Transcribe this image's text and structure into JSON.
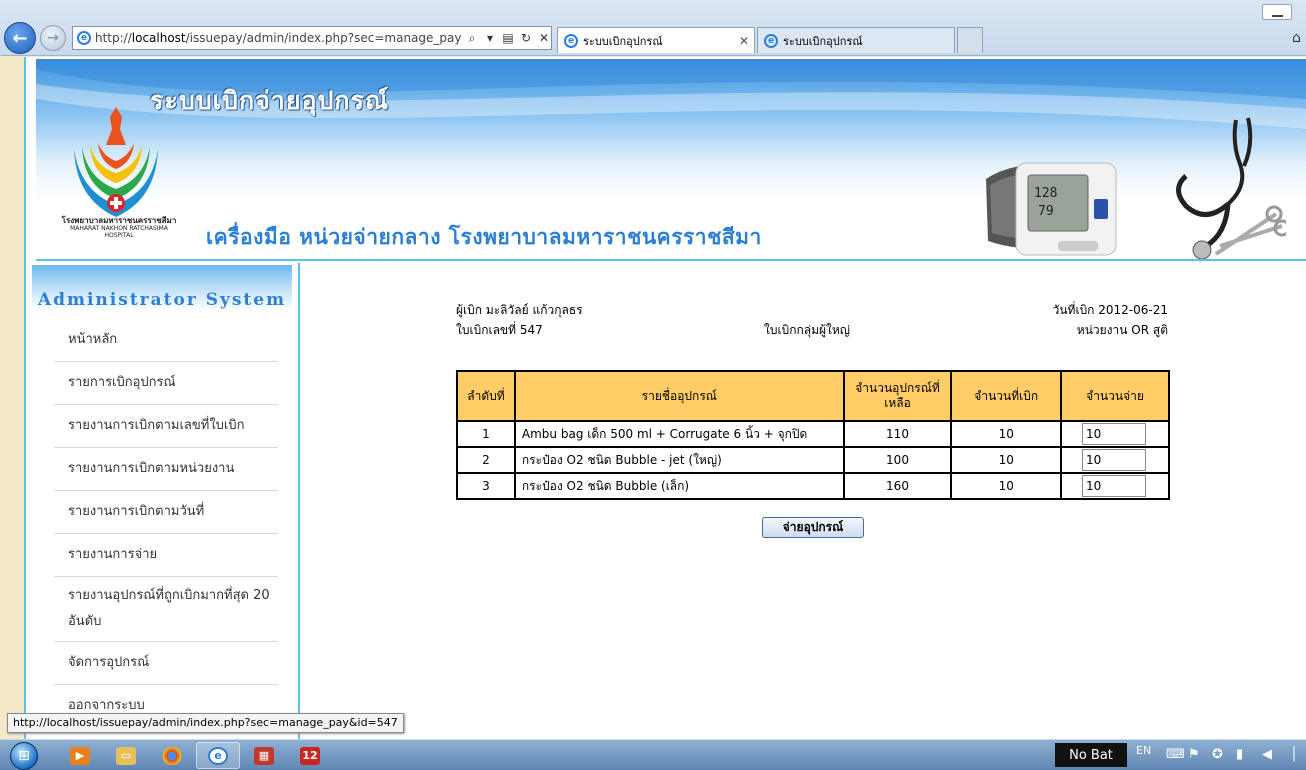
{
  "browser": {
    "url_prefix": "http://",
    "url_host": "localhost",
    "url_path": "/issuepay/admin/index.php?sec=manage_pay&id=547",
    "tabs": [
      {
        "title": "ระบบเบิกอุปกรณ์"
      },
      {
        "title": "ระบบเบิกอุปกรณ์"
      }
    ],
    "status_url": "http://localhost/issuepay/admin/index.php?sec=manage_pay&id=547"
  },
  "banner": {
    "system_title": "ระบบเบิกจ่ายอุปกรณ์",
    "unit_heading": "เครื่องมือ หน่วยจ่ายกลาง โรงพยาบาลมหาราชนครราชสีมา",
    "logo_caption_th": "โรงพยาบาลมหาราชนครราชสีมา",
    "logo_caption_en": "MAHARAT NAKHON RATCHASIMA HOSPITAL"
  },
  "sidebar": {
    "title": "Administrator System",
    "items": [
      {
        "label": "หน้าหลัก"
      },
      {
        "label": "รายการเบิกอุปกรณ์"
      },
      {
        "label": "รายงานการเบิกตามเลขที่ใบเบิก"
      },
      {
        "label": "รายงานการเบิกตามหน่วยงาน"
      },
      {
        "label": "รายงานการเบิกตามวันที่"
      },
      {
        "label": "รายงานการจ่าย"
      },
      {
        "label": "รายงานอุปกรณ์ที่ถูกเบิกมากที่สุด 20 อันดับ"
      },
      {
        "label": "จัดการอุปกรณ์"
      },
      {
        "label": "ออกจากระบบ"
      }
    ]
  },
  "requisition": {
    "requester": "ผู้เบิก  มะลิวัลย์  แก้วกุลธร",
    "request_date": "วันที่เบิก  2012-06-21",
    "request_no": "ใบเบิกเลขที่  547",
    "group": "ใบเบิกกลุ่มผู้ใหญ่",
    "department": "หน่วยงาน  OR สูติ"
  },
  "table": {
    "headers": [
      "ลำดับที่",
      "รายชื่ออุปกรณ์",
      "จำนวนอุปกรณ์ที่เหลือ",
      "จำนวนที่เบิก",
      "จำนวนจ่าย"
    ],
    "rows": [
      {
        "no": "1",
        "name": "Ambu bag เด็ก 500 ml + Corrugate 6 นิ้ว + จุกปิด",
        "remaining": "110",
        "requested": "10",
        "pay": "10"
      },
      {
        "no": "2",
        "name": "กระป๋อง O2 ชนิด Bubble - jet (ใหญ่)",
        "remaining": "100",
        "requested": "10",
        "pay": "10"
      },
      {
        "no": "3",
        "name": "กระป๋อง O2 ชนิด Bubble (เล็ก)",
        "remaining": "160",
        "requested": "10",
        "pay": "10"
      }
    ]
  },
  "actions": {
    "submit_label": "จ่ายอุปกรณ์"
  },
  "taskbar": {
    "battery_label": "No Bat",
    "language": "EN",
    "apps": [
      "media-player-icon",
      "file-explorer-icon",
      "chrome-icon",
      "internet-explorer-icon",
      "app-icon",
      "app-12-icon"
    ]
  },
  "colors": {
    "accent_blue": "#2a7fd6",
    "table_header": "#ffcc66",
    "frame_line": "#5cc2e8"
  }
}
